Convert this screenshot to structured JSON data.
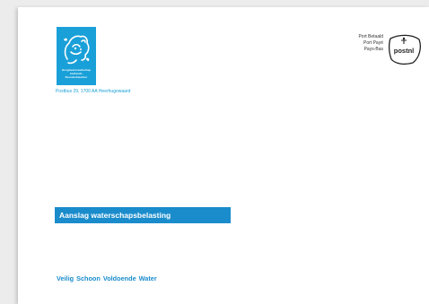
{
  "logo": {
    "line1": "Hoogheemraadschap",
    "line2": "Hollands",
    "line3": "Noorderkwartier"
  },
  "return_address": "Postbus 29, 1700 AA Heerhugowaard",
  "postage": {
    "line1": "Port Betaald",
    "line2": "Port Payé",
    "line3": "Pays-Bas",
    "brand": "postnl"
  },
  "banner_label": "Aanslag waterschapsbelasting",
  "slogan": "Veilig Schoon Voldoende Water",
  "colors": {
    "brand_blue": "#1aa0d8",
    "banner_blue": "#1a8ccc"
  }
}
